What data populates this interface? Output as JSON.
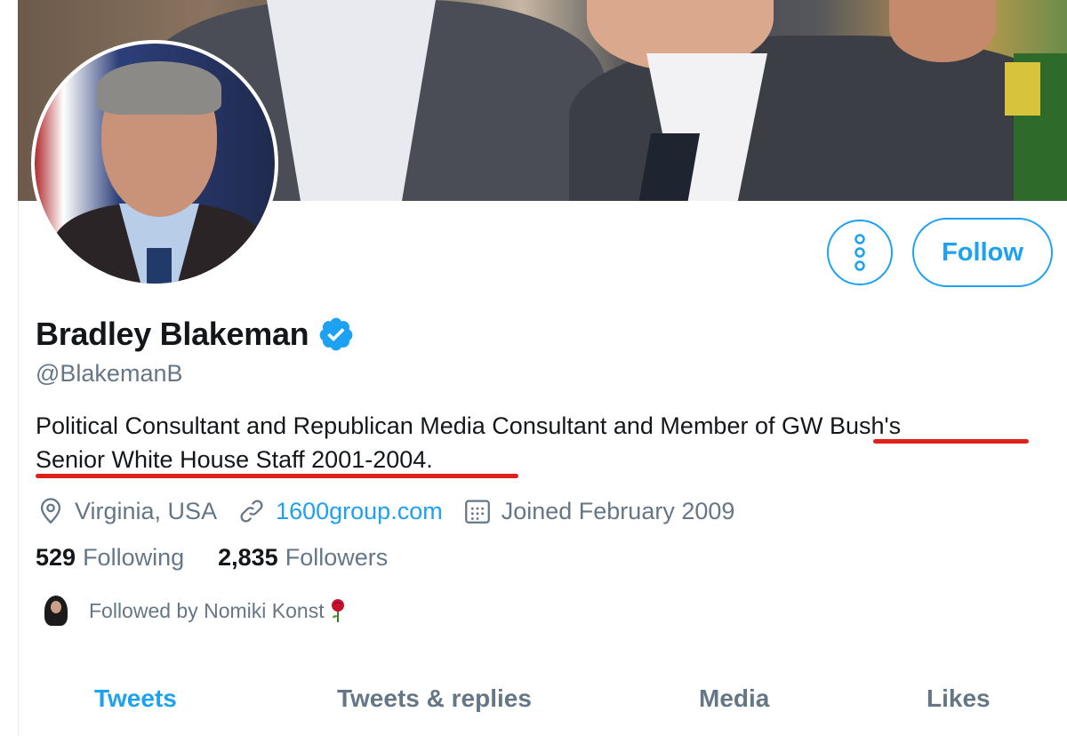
{
  "profile": {
    "name": "Bradley Blakeman",
    "handle": "@BlakemanB",
    "verified": true,
    "bio_part1": "Political Consultant and Republican Media Consultant and Member of ",
    "bio_part2": "GW Bush's",
    "bio_line2": "Senior White House Staff 2001-2004.",
    "location": "Virginia, USA",
    "website": "1600group.com",
    "joined": "Joined February 2009",
    "following_count": "529",
    "following_label": "Following",
    "followers_count": "2,835",
    "followers_label": "Followers",
    "followed_by": "Followed by Nomiki Konst"
  },
  "actions": {
    "follow_label": "Follow"
  },
  "tabs": [
    {
      "label": "Tweets",
      "active": true
    },
    {
      "label": "Tweets & replies",
      "active": false
    },
    {
      "label": "Media",
      "active": false
    },
    {
      "label": "Likes",
      "active": false
    }
  ],
  "colors": {
    "accent": "#1da1f2",
    "secondary_text": "#657786",
    "annotation_underline": "#e0201b"
  },
  "icons": [
    "location-icon",
    "link-icon",
    "calendar-icon",
    "more-options-icon",
    "verified-badge-icon",
    "rose-emoji-icon"
  ]
}
